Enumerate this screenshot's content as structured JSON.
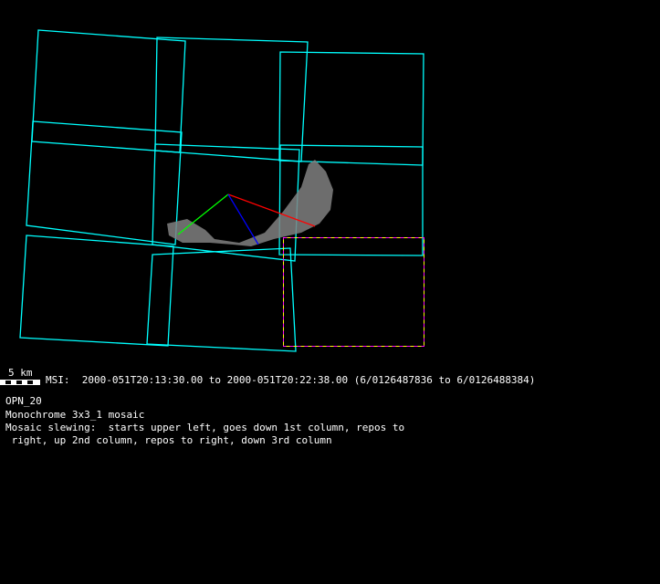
{
  "scale_bar": {
    "label": "5 km"
  },
  "header_line": "MSI:  2000-051T20:13:30.00 to 2000-051T20:22:38.00 (6/0126487836 to 6/0126488384)",
  "info_lines": [
    "OPN_20",
    "Monochrome 3x3_1 mosaic",
    "Mosaic slewing:  starts upper left, goes down 1st column, repos to",
    " right, up 2nd column, repos to right, down 3rd column"
  ],
  "colors": {
    "frame": "#00ffff",
    "highlight_a": "#ff00ff",
    "highlight_b": "#ffff00",
    "body": "#808080",
    "axis_x": "#ff0000",
    "axis_y": "#00ff00",
    "axis_z": "#0000ff"
  }
}
